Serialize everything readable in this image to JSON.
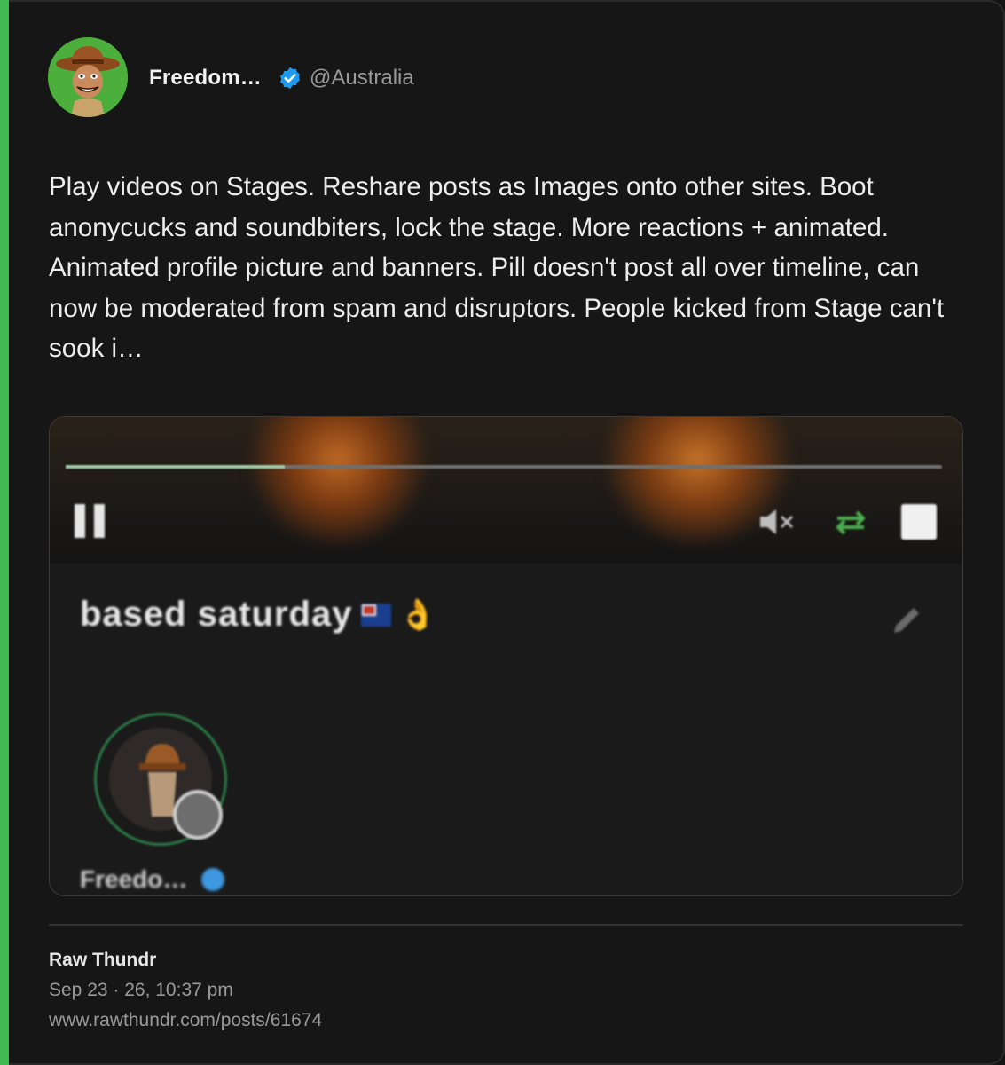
{
  "post": {
    "author_name": "Freedom…",
    "handle": "@Australia",
    "text": "Play videos on Stages. Reshare posts as Images onto other sites. Boot anonycucks and soundbiters, lock the stage. More reactions + animated. Animated profile picture and banners. Pill doesn't post all over timeline, can now be moderated from spam and disruptors. People kicked from Stage can't sook i…"
  },
  "media": {
    "stage_title": "based saturday",
    "speaker_name": "Freedo…",
    "progress_fraction": 0.25
  },
  "footer": {
    "source": "Raw Thundr",
    "timestamp": "Sep 23 · 26, 10:37 pm",
    "url": "www.rawthundr.com/posts/61674"
  },
  "colors": {
    "accent_bar": "#3fb950",
    "verified_badge": "#1d9bf0",
    "card_bg": "#161616"
  },
  "icons": [
    "verified-badge-icon",
    "pause-icon",
    "mute-icon",
    "loop-icon",
    "fullscreen-icon",
    "edit-pencil-icon",
    "australia-flag-icon",
    "ok-hand-icon"
  ]
}
